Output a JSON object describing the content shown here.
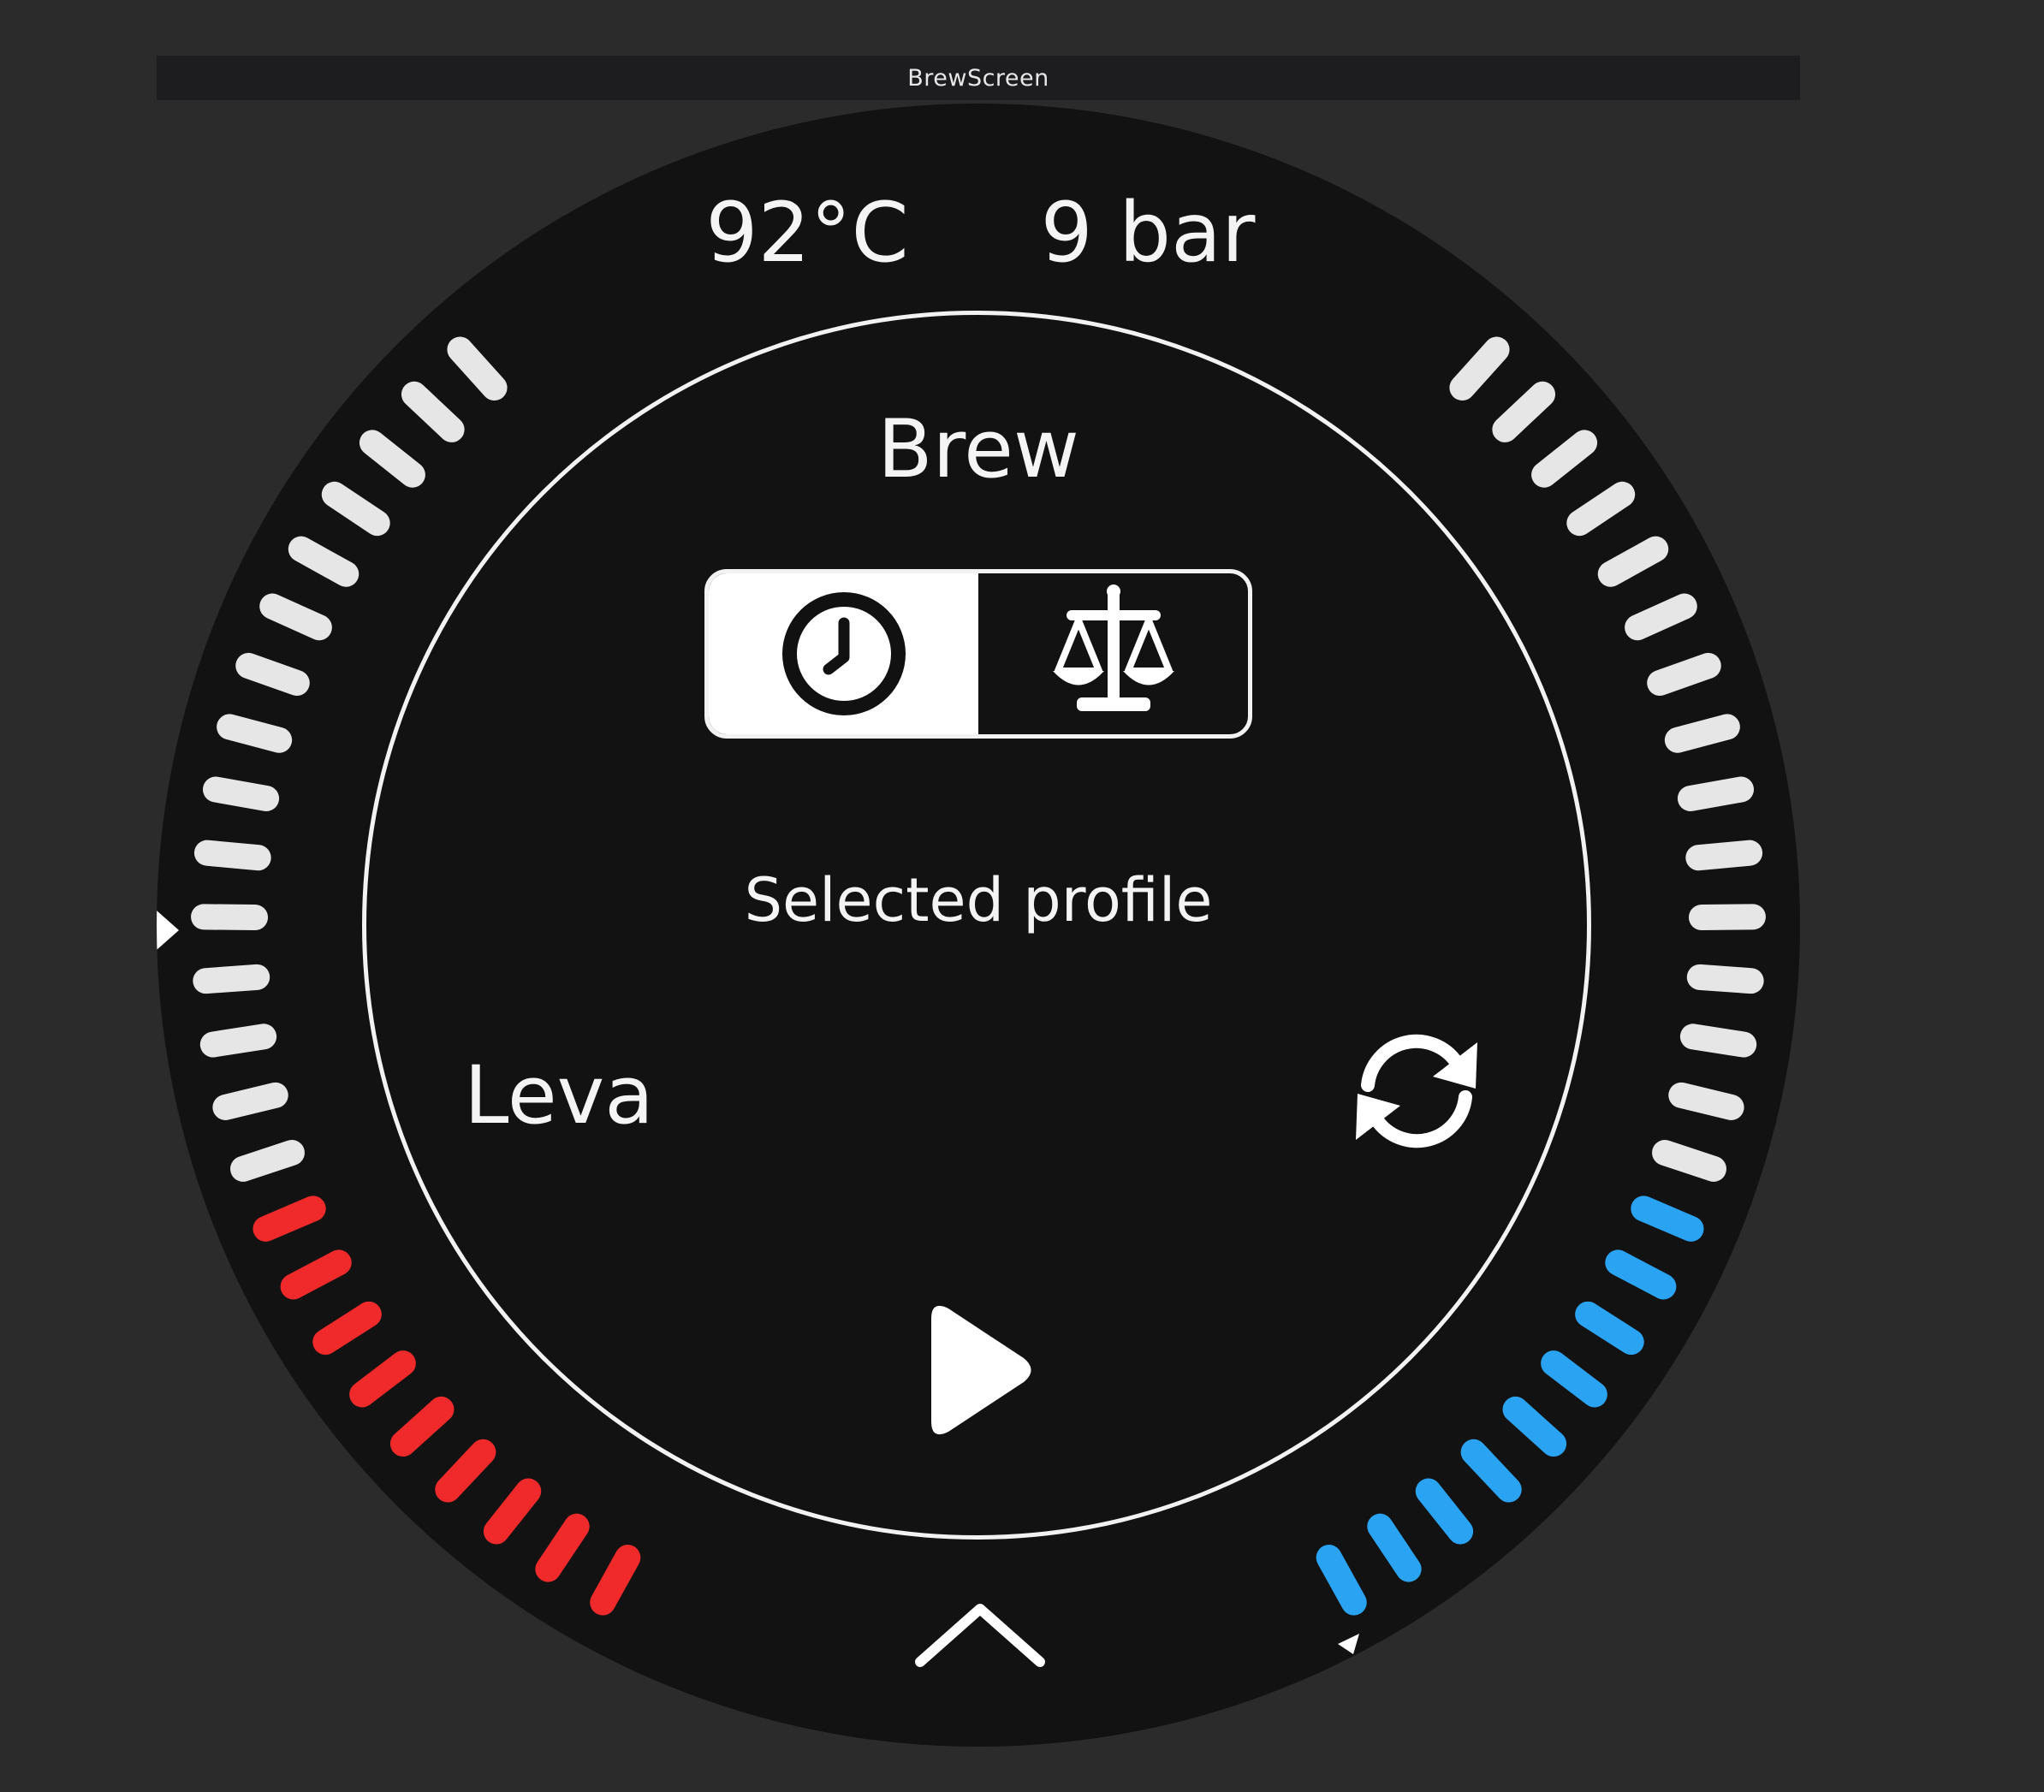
{
  "window": {
    "title": "BrewScreen"
  },
  "status": {
    "temperature": "92°C",
    "pressure": "9 bar"
  },
  "screen": {
    "title": "Brew",
    "profile_label": "Selected profile",
    "profile_name": "Leva"
  },
  "mode_toggle": {
    "options": [
      {
        "icon": "clock-icon",
        "active": true
      },
      {
        "icon": "scale-icon",
        "active": false
      }
    ]
  },
  "actions": {
    "refresh_icon": "refresh-icon",
    "start_icon": "play-icon",
    "expand_icon": "chevron-up-icon"
  },
  "gauges": {
    "temperature": {
      "fill": 0.36,
      "color": "#f02a2a",
      "track_color": "#e6e6e6"
    },
    "pressure": {
      "fill": 0.38,
      "color": "#2aa4f2",
      "track_color": "#e6e6e6"
    }
  }
}
